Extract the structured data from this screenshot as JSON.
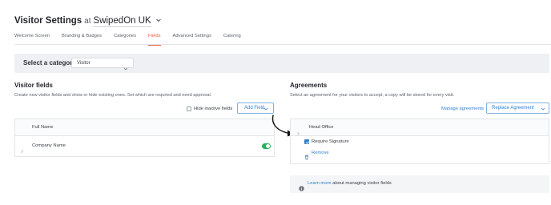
{
  "header": {
    "title": "Visitor Settings",
    "at": "at",
    "site": "SwipedOn UK"
  },
  "tabs": [
    {
      "label": "Welcome Screen",
      "active": false
    },
    {
      "label": "Branding & Badges",
      "active": false
    },
    {
      "label": "Categories",
      "active": false
    },
    {
      "label": "Fields",
      "active": true
    },
    {
      "label": "Advanced Settings",
      "active": false
    },
    {
      "label": "Catering",
      "active": false
    }
  ],
  "category": {
    "label": "Select a category",
    "selected": "Visitor"
  },
  "visitor_fields": {
    "heading": "Visitor fields",
    "description": "Create new visitor fields and show or hide existing ones. Set which are required and need approval.",
    "hide_inactive_label": "Hide inactive fields",
    "hide_inactive_checked": false,
    "add_field_label": "Add Field",
    "rows": [
      {
        "name": "Full Name",
        "toggle_on": false
      },
      {
        "name": "Company Name",
        "toggle_on": true
      }
    ]
  },
  "agreements": {
    "heading": "Agreements",
    "description": "Select an agreement for your visitors to accept, a copy will be stored for every visit.",
    "manage_label": "Manage agreements",
    "replace_label": "Replace Agreement",
    "agreement_name": "Head Office",
    "require_signature_label": "Require Signature",
    "require_signature_checked": true,
    "remove_label": "Remove"
  },
  "info": {
    "link_text": "Learn more",
    "rest_text": "about managing visitor fields"
  },
  "colors": {
    "accent_active_tab": "#ef5b3d",
    "link_blue": "#2f7fcf",
    "toggle_green": "#22b45a"
  }
}
